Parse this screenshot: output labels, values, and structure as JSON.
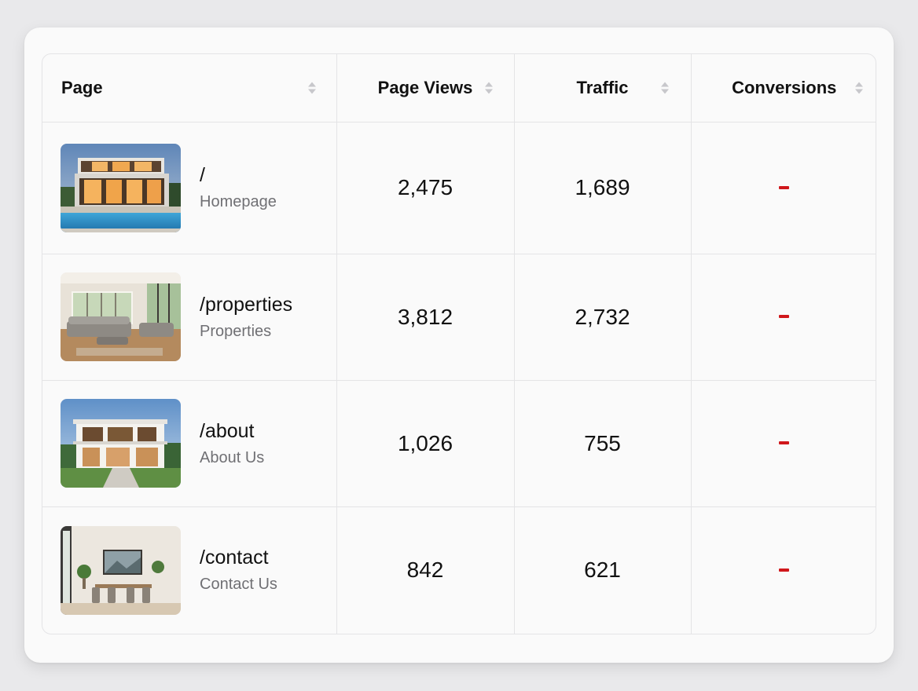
{
  "table": {
    "headers": {
      "page": "Page",
      "page_views": "Page Views",
      "traffic": "Traffic",
      "conversions": "Conversions"
    },
    "rows": [
      {
        "path": "/",
        "name": "Homepage",
        "page_views": "2,475",
        "traffic": "1,689",
        "conversions": "-",
        "thumbnail": "modern-house-pool-dusk"
      },
      {
        "path": "/properties",
        "name": "Properties",
        "page_views": "3,812",
        "traffic": "2,732",
        "conversions": "-",
        "thumbnail": "bright-living-room"
      },
      {
        "path": "/about",
        "name": "About Us",
        "page_views": "1,026",
        "traffic": "755",
        "conversions": "-",
        "thumbnail": "white-modern-house-day"
      },
      {
        "path": "/contact",
        "name": "Contact Us",
        "page_views": "842",
        "traffic": "621",
        "conversions": "-",
        "thumbnail": "dining-room-interior"
      }
    ]
  },
  "colors": {
    "conversion_dash": "#d0171b",
    "secondary_text": "#707074",
    "border": "#e4e4e6"
  }
}
